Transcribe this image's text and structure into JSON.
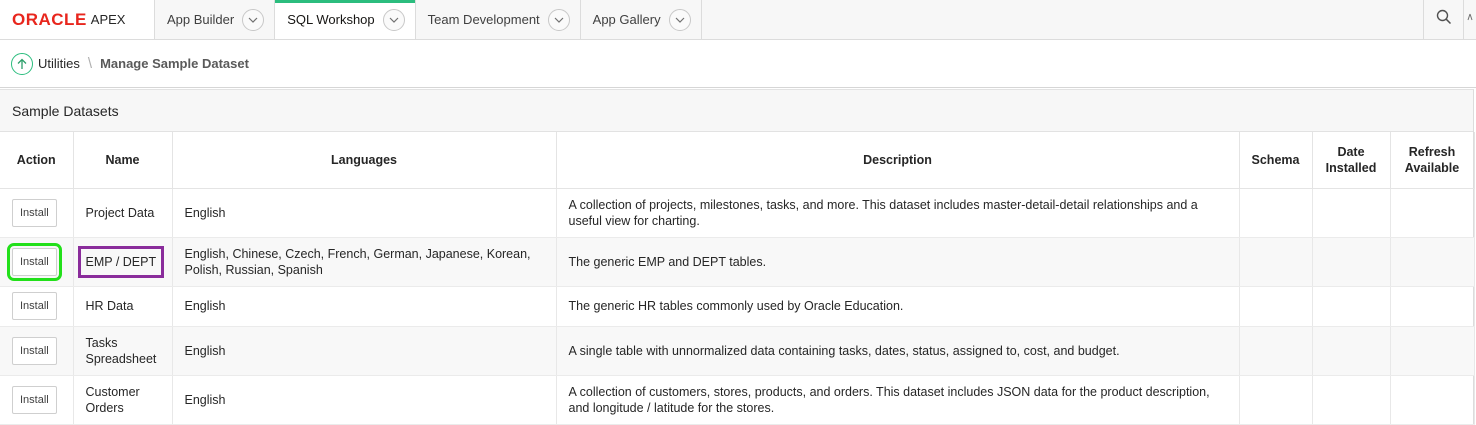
{
  "brand": {
    "oracle": "ORACLE",
    "apex": "APEX"
  },
  "nav": {
    "tabs": [
      {
        "label": "App Builder",
        "active": false
      },
      {
        "label": "SQL Workshop",
        "active": true
      },
      {
        "label": "Team Development",
        "active": false
      },
      {
        "label": "App Gallery",
        "active": false
      }
    ],
    "search_icon": "search-icon",
    "accent_color": "#2bbd7e"
  },
  "breadcrumb": {
    "parent": "Utilities",
    "separator": "\\",
    "current": "Manage Sample Dataset"
  },
  "region": {
    "title": "Sample Datasets",
    "columns": {
      "action": "Action",
      "name": "Name",
      "languages": "Languages",
      "description": "Description",
      "schema": "Schema",
      "date_installed": "Date Installed",
      "refresh_available": "Refresh Available"
    },
    "rows": [
      {
        "action": "Install",
        "name": "Project Data",
        "languages": "English",
        "description": "A collection of projects, milestones, tasks, and more. This dataset includes master-detail-detail relationships and a useful view for charting.",
        "schema": "",
        "date_installed": "",
        "refresh_available": ""
      },
      {
        "action": "Install",
        "name": "EMP / DEPT",
        "languages": "English, Chinese, Czech, French, German, Japanese, Korean, Polish, Russian, Spanish",
        "description": "The generic EMP and DEPT tables.",
        "schema": "",
        "date_installed": "",
        "refresh_available": ""
      },
      {
        "action": "Install",
        "name": "HR Data",
        "languages": "English",
        "description": "The generic HR tables commonly used by Oracle Education.",
        "schema": "",
        "date_installed": "",
        "refresh_available": ""
      },
      {
        "action": "Install",
        "name": "Tasks Spreadsheet",
        "languages": "English",
        "description": "A single table with unnormalized data containing tasks, dates, status, assigned to, cost, and budget.",
        "schema": "",
        "date_installed": "",
        "refresh_available": ""
      },
      {
        "action": "Install",
        "name": "Customer Orders",
        "languages": "English",
        "description": "A collection of customers, stores, products, and orders. This dataset includes JSON data for the product description, and longitude / latitude for the stores.",
        "schema": "",
        "date_installed": "",
        "refresh_available": ""
      }
    ]
  }
}
